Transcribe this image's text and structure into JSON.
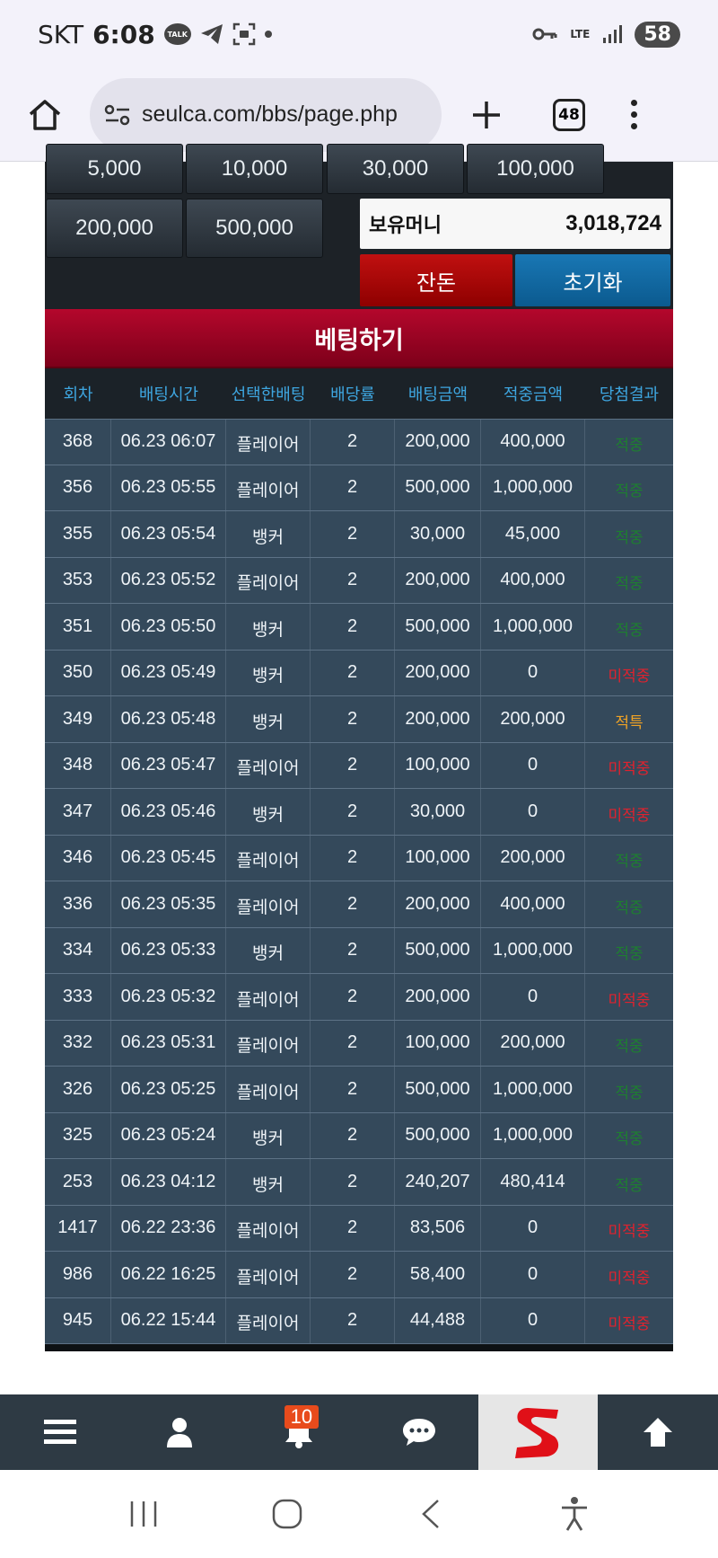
{
  "status_bar": {
    "carrier": "SKT",
    "time": "6:08",
    "talk_label": "TALK",
    "network": "LTE",
    "battery": "58"
  },
  "browser": {
    "url": "seulca.com/bbs/page.php",
    "tab_count": "48"
  },
  "chips": {
    "row1": [
      "5,000",
      "10,000",
      "30,000",
      "100,000"
    ],
    "row2": [
      "200,000",
      "500,000"
    ]
  },
  "wallet": {
    "label": "보유머니",
    "value": "3,018,724",
    "balance_button": "잔돈",
    "reset_button": "초기화"
  },
  "bet_section": {
    "title": "베팅하기"
  },
  "table": {
    "headers": [
      "회차",
      "배팅시간",
      "선택한배팅",
      "배당률",
      "배팅금액",
      "적중금액",
      "당첨결과"
    ],
    "rows": [
      [
        "368",
        "06.23 06:07",
        "플레이어",
        "2",
        "200,000",
        "400,000",
        "적중"
      ],
      [
        "356",
        "06.23 05:55",
        "플레이어",
        "2",
        "500,000",
        "1,000,000",
        "적중"
      ],
      [
        "355",
        "06.23 05:54",
        "뱅커",
        "2",
        "30,000",
        "45,000",
        "적중"
      ],
      [
        "353",
        "06.23 05:52",
        "플레이어",
        "2",
        "200,000",
        "400,000",
        "적중"
      ],
      [
        "351",
        "06.23 05:50",
        "뱅커",
        "2",
        "500,000",
        "1,000,000",
        "적중"
      ],
      [
        "350",
        "06.23 05:49",
        "뱅커",
        "2",
        "200,000",
        "0",
        "미적중"
      ],
      [
        "349",
        "06.23 05:48",
        "뱅커",
        "2",
        "200,000",
        "200,000",
        "적특"
      ],
      [
        "348",
        "06.23 05:47",
        "플레이어",
        "2",
        "100,000",
        "0",
        "미적중"
      ],
      [
        "347",
        "06.23 05:46",
        "뱅커",
        "2",
        "30,000",
        "0",
        "미적중"
      ],
      [
        "346",
        "06.23 05:45",
        "플레이어",
        "2",
        "100,000",
        "200,000",
        "적중"
      ],
      [
        "336",
        "06.23 05:35",
        "플레이어",
        "2",
        "200,000",
        "400,000",
        "적중"
      ],
      [
        "334",
        "06.23 05:33",
        "뱅커",
        "2",
        "500,000",
        "1,000,000",
        "적중"
      ],
      [
        "333",
        "06.23 05:32",
        "플레이어",
        "2",
        "200,000",
        "0",
        "미적중"
      ],
      [
        "332",
        "06.23 05:31",
        "플레이어",
        "2",
        "100,000",
        "200,000",
        "적중"
      ],
      [
        "326",
        "06.23 05:25",
        "플레이어",
        "2",
        "500,000",
        "1,000,000",
        "적중"
      ],
      [
        "325",
        "06.23 05:24",
        "뱅커",
        "2",
        "500,000",
        "1,000,000",
        "적중"
      ],
      [
        "253",
        "06.23 04:12",
        "뱅커",
        "2",
        "240,207",
        "480,414",
        "적중"
      ],
      [
        "1417",
        "06.22 23:36",
        "플레이어",
        "2",
        "83,506",
        "0",
        "미적중"
      ],
      [
        "986",
        "06.22 16:25",
        "플레이어",
        "2",
        "58,400",
        "0",
        "미적중"
      ],
      [
        "945",
        "06.22 15:44",
        "플레이어",
        "2",
        "44,488",
        "0",
        "미적중"
      ]
    ],
    "result_colors": {
      "적중": "#1e7f30",
      "미적중": "#e0222e",
      "적특": "#f0a325"
    }
  },
  "site_nav": {
    "notification_count": "10",
    "icons": [
      "menu-icon",
      "user-icon",
      "bell-icon",
      "chat-icon",
      "site-logo",
      "arrow-up-icon"
    ]
  },
  "colors": {
    "header_red": "#b4072c",
    "table_row": "#34495b",
    "header_text_blue": "#3ea6e0"
  }
}
